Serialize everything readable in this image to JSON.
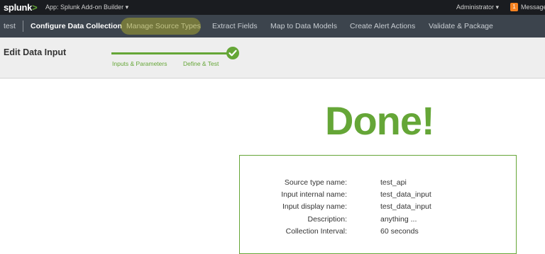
{
  "topbar": {
    "logo_text": "splunk",
    "logo_suffix": ">",
    "app_menu": "App: Splunk Add-on Builder ▾",
    "user_menu": "Administrator ▾",
    "messages_count": "1",
    "messages_label": "Messages"
  },
  "nav": {
    "addon_name": "test",
    "items": [
      {
        "label": "Configure Data Collection"
      },
      {
        "label": "Manage Source Types"
      },
      {
        "label": "Extract Fields"
      },
      {
        "label": "Map to Data Models"
      },
      {
        "label": "Create Alert Actions"
      },
      {
        "label": "Validate & Package"
      }
    ]
  },
  "header": {
    "title": "Edit Data Input",
    "steps": [
      "Inputs & Parameters",
      "Define & Test"
    ]
  },
  "main": {
    "done_text": "Done!",
    "summary": [
      {
        "label": "Source type name:",
        "value": "test_api"
      },
      {
        "label": "Input internal name:",
        "value": "test_data_input"
      },
      {
        "label": "Input display name:",
        "value": "test_data_input"
      },
      {
        "label": "Description:",
        "value": "anything ..."
      },
      {
        "label": "Collection Interval:",
        "value": "60 seconds"
      }
    ]
  },
  "colors": {
    "accent_green": "#65a637",
    "topbar_bg": "#1a1c20",
    "navbar_bg": "#3c444d",
    "badge_orange": "#f58220"
  }
}
